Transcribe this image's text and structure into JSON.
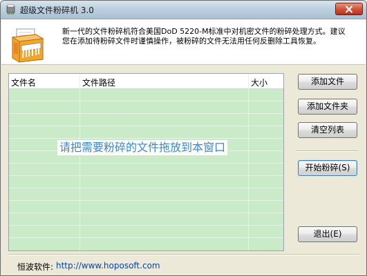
{
  "window": {
    "title": "超级文件粉碎机  3.0"
  },
  "header": {
    "description": "新一代的文件粉碎机符合美国DoD 5220-M标准中对机密文件的粉碎处理方式。建议您在添加待粉碎文件时谨慎操作，被粉碎的文件无法用任何反删除工具恢复。"
  },
  "file_list": {
    "columns": [
      "文件名",
      "文件路径",
      "大小"
    ],
    "drop_hint": "请把需要粉碎的文件拖放到本窗口"
  },
  "buttons": {
    "add_file": "添加文件",
    "add_folder": "添加文件夹",
    "clear_list": "清空列表",
    "start_shred": "开始粉碎(S)",
    "exit": "退出(E)"
  },
  "footer": {
    "label": "恒波软件:",
    "link": "http://www.hoposoft.com"
  },
  "colors": {
    "list_background": "#c9ebc7",
    "hint_text": "#3b87cf",
    "link_text": "#0645ad"
  }
}
